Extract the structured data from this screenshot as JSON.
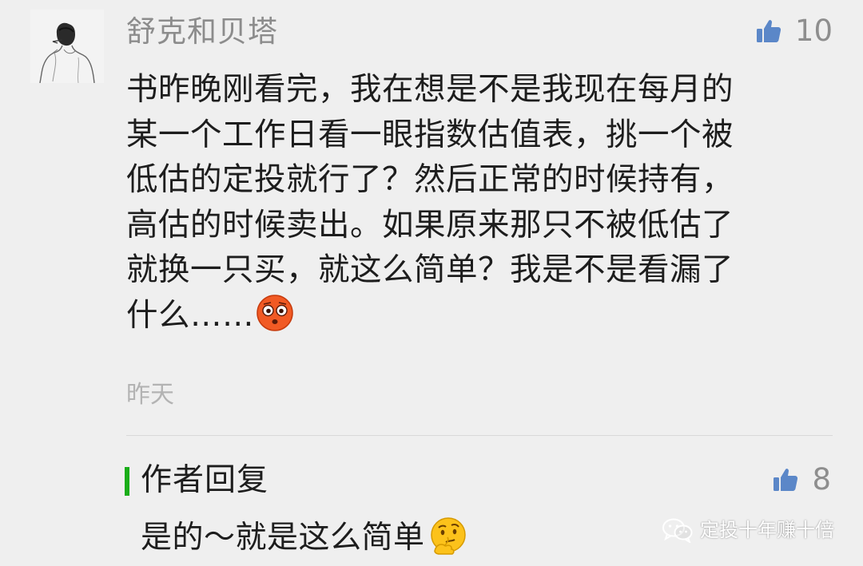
{
  "comment": {
    "username": "舒克和贝塔",
    "likes": "10",
    "lines": [
      "书昨晚刚看完，我在想是不是我现在每月的",
      "某一个工作日看一眼指数估值表，挑一个被",
      "低估的定投就行了？然后正常的时候持有，",
      "高估的时候卖出。如果原来那只不被低估了",
      "就换一只买，就这么简单？我是不是看漏了",
      "什么……"
    ],
    "time": "昨天",
    "avatar_icon": "sketch-person-avatar",
    "emoji": "flushed-face-emoji"
  },
  "reply": {
    "title": "作者回复",
    "likes": "8",
    "text": "是的～就是这么简单",
    "emoji": "thinking-face-emoji",
    "bar_color": "#1aad19"
  },
  "watermark": {
    "text": "定投十年赚十倍",
    "icon": "wechat-icon"
  },
  "colors": {
    "background": "#efefef",
    "meta_gray": "#8c8c8c",
    "text": "#1d1d1d",
    "time_gray": "#b3b3b3"
  }
}
